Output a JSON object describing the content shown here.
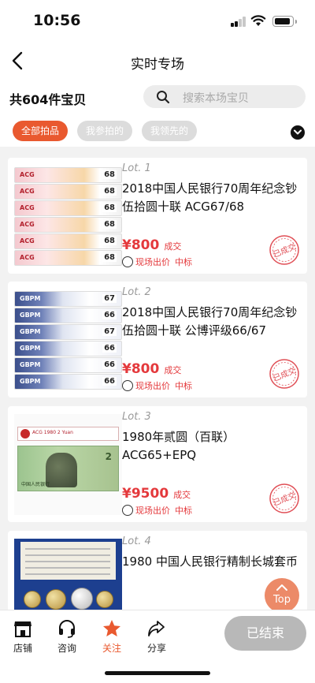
{
  "status_bar": {
    "time": "10:56"
  },
  "nav": {
    "title": "实时专场"
  },
  "header": {
    "item_count": "共604件宝贝",
    "search_placeholder": "搜索本场宝贝"
  },
  "filters": [
    "全部拍品",
    "我参拍的",
    "我领先的"
  ],
  "lots": [
    {
      "lot_no": "Lot. 1",
      "title": "2018中国人民银行70周年纪念钞伍拾圆十联 ACG67/68",
      "price": "¥800",
      "status": "成交",
      "bid_source": "现场出价",
      "bid_result": "中标",
      "grades": [
        "68",
        "68",
        "68",
        "68",
        "68",
        "68"
      ],
      "grader": "ACG"
    },
    {
      "lot_no": "Lot. 2",
      "title": "2018中国人民银行70周年纪念钞伍拾圆十联 公博评级66/67",
      "price": "¥800",
      "status": "成交",
      "bid_source": "现场出价",
      "bid_result": "中标",
      "grades": [
        "67",
        "66",
        "67",
        "66",
        "66",
        "66"
      ],
      "grader": "GBPM"
    },
    {
      "lot_no": "Lot. 3",
      "title": "1980年贰圆（百联）ACG65+EPQ",
      "price": "¥9500",
      "status": "成交",
      "bid_source": "现场出价",
      "bid_result": "中标"
    },
    {
      "lot_no": "Lot. 4",
      "title": "1980 中国人民银行精制长城套币"
    }
  ],
  "stamp_text": "已成交",
  "top_button": "Top",
  "tabs": [
    {
      "label": "店铺",
      "icon": "shop-icon"
    },
    {
      "label": "咨询",
      "icon": "headset-icon"
    },
    {
      "label": "关注",
      "icon": "star-icon"
    },
    {
      "label": "分享",
      "icon": "share-icon"
    }
  ],
  "end_button": "已结束",
  "colors": {
    "accent": "#e9592f",
    "price": "#e4393c",
    "chip_inactive": "#dcdcdc",
    "end_button": "#b8b8b8"
  }
}
